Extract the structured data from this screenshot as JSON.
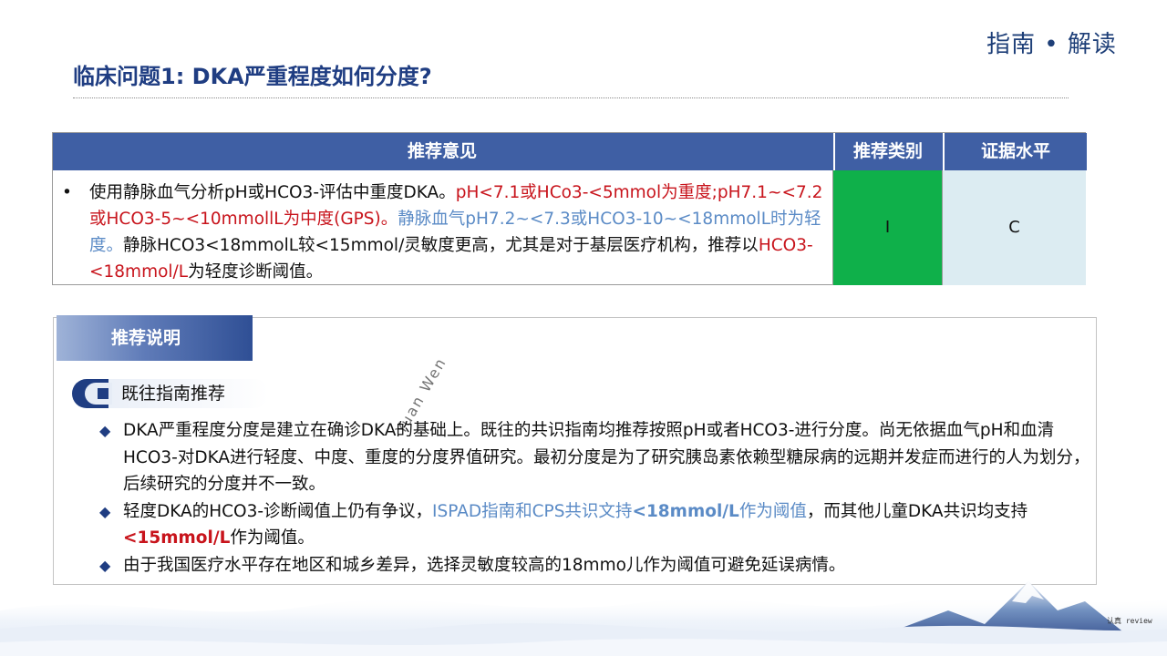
{
  "brand": "指南 • 解读",
  "title": "临床问题1: DKA严重程度如何分度?",
  "recommendation_table": {
    "headers": {
      "opinion": "推荐意见",
      "type": "推荐类别",
      "level": "证据水平"
    },
    "bullet": "•",
    "segments": [
      "使用静脉血气分析pH或HCO3-评估中重度DKA。",
      "pH<7.1或HCo3-<5mmol为重度;pH7.1~<7.2或HCO3-5~<10mmollL为中度(GPS)。",
      "静脉血气pH7.2~<7.3或HCO3-10~<18mmolL时为轻度。",
      "静脉HCO3<18mmolL较<15mmol/灵敏度更高，尤其是对于基层医疗机构，推荐以",
      "HCO3-<18mmol/L",
      "为轻度诊断阈值。"
    ],
    "type_value": "I",
    "level_value": "C",
    "colors": {
      "header_bg": "#3f5fa4",
      "type_bg": "#0fb04a",
      "level_bg": "#dcecf2",
      "red": "#c8141c",
      "blue": "#5b8bc6"
    }
  },
  "explanation": {
    "tab_label": "推荐说明",
    "subsection_label": "既往指南推荐",
    "marker": "◆",
    "points": [
      {
        "parts": [
          "DKA严重程度分度是建立在确诊DKA的基础上。既往的共识指南均推荐按照pH或者HCO3-进行分度。尚无依据血气pH和血清HCO3-对DKA进行轻度、中度、重度的分度界值研究。最初分度是为了研究胰岛素依赖型糖尿病的远期并发症而进行的人为划分，后续研究的分度并不一致。"
        ]
      },
      {
        "parts": [
          "轻度DKA的HCO3-诊断阈值上仍有争议，",
          "ISPAD指南和CPS共识文持",
          "<18mmol/L",
          "作为阈值",
          "，而其他儿童DKA共识均支持",
          "<15mmol/L",
          "作为阈值。"
        ]
      },
      {
        "parts": [
          "由于我国医疗水平存在地区和城乡差异，选择灵敏度较高的18mmo儿作为阈值可避免延误病情。"
        ]
      }
    ]
  },
  "watermark": "Yuan Wen",
  "footer_tag": "认真 review"
}
